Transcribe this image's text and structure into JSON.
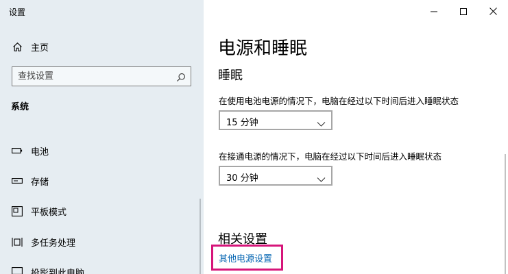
{
  "window": {
    "title": "设置",
    "controls": [
      "minimize",
      "maximize",
      "close"
    ]
  },
  "sidebar": {
    "home_label": "主页",
    "search_placeholder": "查找设置",
    "section_title": "系统",
    "items": [
      {
        "label": "电池",
        "icon": "battery-icon"
      },
      {
        "label": "存储",
        "icon": "storage-icon"
      },
      {
        "label": "平板模式",
        "icon": "tablet-mode-icon"
      },
      {
        "label": "多任务处理",
        "icon": "multitasking-icon"
      },
      {
        "label": "投影到此电脑",
        "icon": "project-icon"
      }
    ]
  },
  "main": {
    "title": "电源和睡眠",
    "sleep": {
      "heading": "睡眠",
      "battery_label": "在使用电池电源的情况下，电脑在经过以下时间后进入睡眠状态",
      "battery_value": "15 分钟",
      "plugged_label": "在接通电源的情况下，电脑在经过以下时间后进入睡眠状态",
      "plugged_value": "30 分钟"
    },
    "related": {
      "heading": "相关设置",
      "link": "其他电源设置"
    }
  },
  "colors": {
    "sidebar_bg": "#e6edf2",
    "link": "#0063b1",
    "highlight": "#d6157a"
  }
}
